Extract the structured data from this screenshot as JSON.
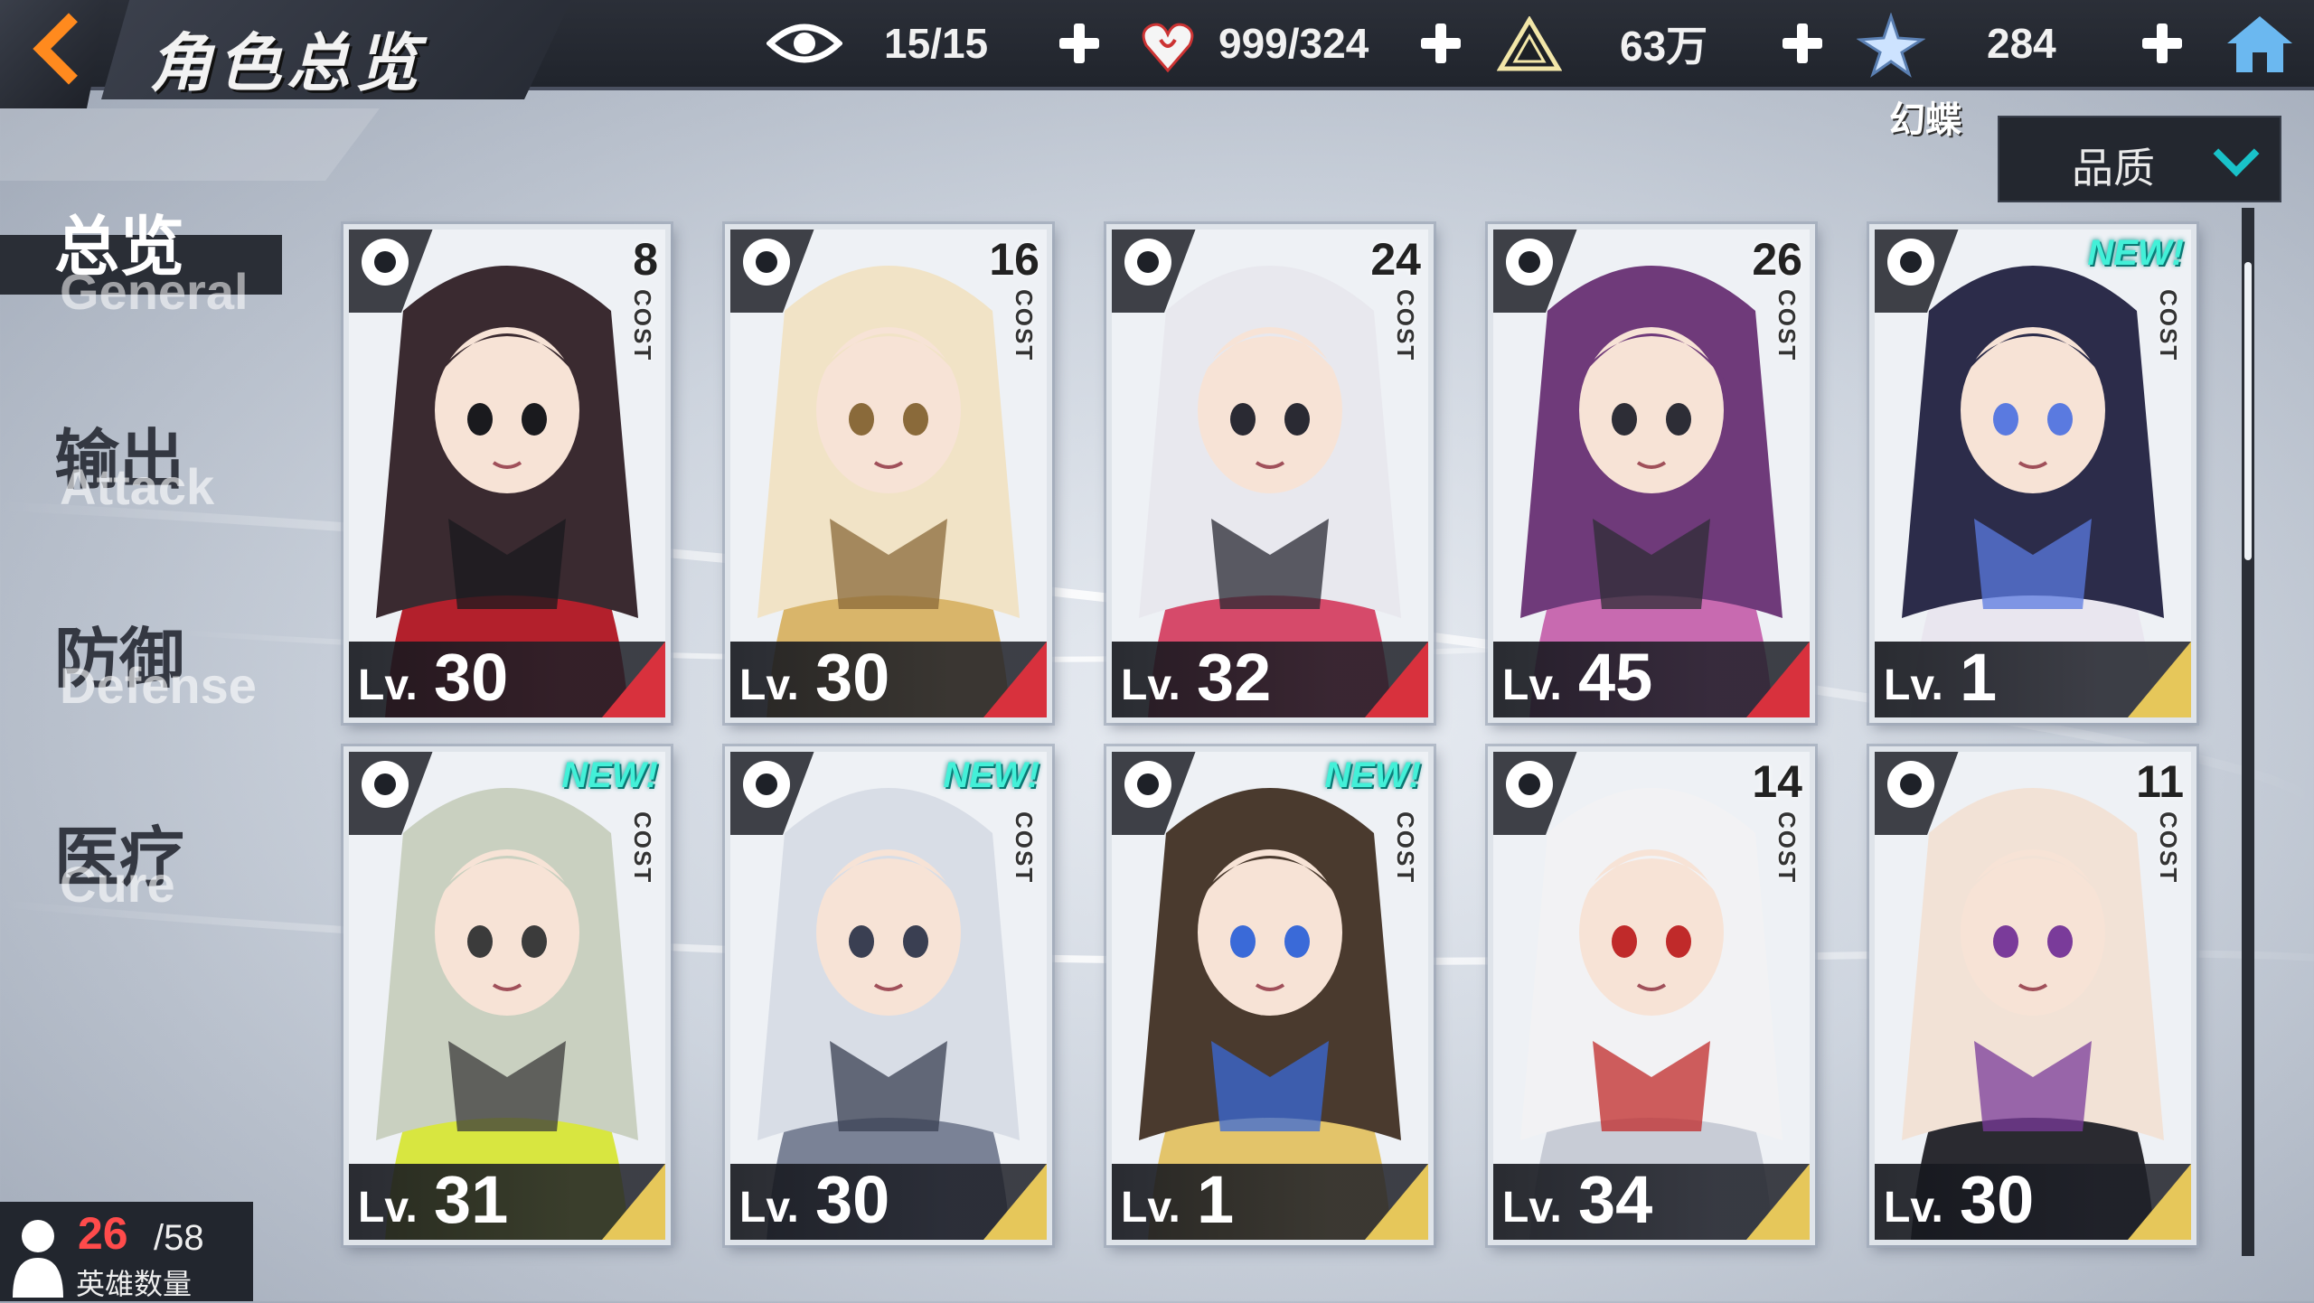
{
  "header": {
    "title": "角色总览",
    "resources": [
      {
        "icon": "eye-icon",
        "value": "15/15"
      },
      {
        "icon": "heart-hand-icon",
        "value": "999/324"
      },
      {
        "icon": "triangle-crystal-icon",
        "value": "63万"
      },
      {
        "icon": "star-shard-icon",
        "value": "284"
      }
    ]
  },
  "attribute_label": "幻蝶",
  "sort": {
    "label": "品质"
  },
  "nav": {
    "items": [
      {
        "zh": "总览",
        "en": "General",
        "active": true
      },
      {
        "zh": "输出",
        "en": "Attack",
        "active": false
      },
      {
        "zh": "防御",
        "en": "Defense",
        "active": false
      },
      {
        "zh": "医疗",
        "en": "Cure",
        "active": false
      }
    ]
  },
  "cards": [
    {
      "role": "shuriken-icon",
      "cost": "8",
      "level": "30",
      "new": false,
      "rarity": "red"
    },
    {
      "role": "dragon-icon",
      "cost": "16",
      "level": "30",
      "new": false,
      "rarity": "red"
    },
    {
      "role": "demon-skull-icon",
      "cost": "24",
      "level": "32",
      "new": false,
      "rarity": "red"
    },
    {
      "role": "revolver-icon",
      "cost": "26",
      "level": "45",
      "new": false,
      "rarity": "red"
    },
    {
      "role": "fox-mask-icon",
      "cost": "",
      "level": "1",
      "new": true,
      "rarity": "gold"
    },
    {
      "role": "shield-cross-icon",
      "cost": "",
      "level": "31",
      "new": true,
      "rarity": "gold"
    },
    {
      "role": "sword-icon",
      "cost": "",
      "level": "30",
      "new": true,
      "rarity": "gold"
    },
    {
      "role": "winged-heart-icon",
      "cost": "",
      "level": "1",
      "new": true,
      "rarity": "gold"
    },
    {
      "role": "crossbow-icon",
      "cost": "14",
      "level": "34",
      "new": false,
      "rarity": "gold"
    },
    {
      "role": "sword-icon",
      "cost": "11",
      "level": "30",
      "new": false,
      "rarity": "gold"
    }
  ],
  "labels": {
    "cost": "COST",
    "lv": "Lv.",
    "new": "NEW!"
  },
  "hero_count": {
    "current": "26",
    "max": "/58",
    "label": "英雄数量"
  },
  "colors": {
    "accent": "#ff8a1e",
    "teal": "#19c2c9",
    "rarity_red": "#d8313d",
    "rarity_gold": "#e6c75a"
  }
}
